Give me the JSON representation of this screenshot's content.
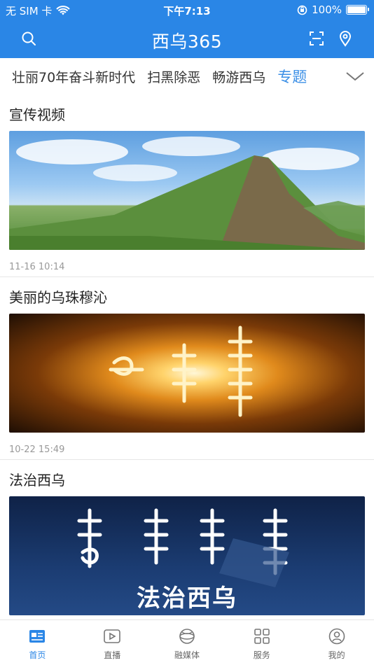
{
  "status_bar": {
    "carrier": "无 SIM 卡",
    "time": "下午7:13",
    "battery": "100%",
    "battery_level": 1.0
  },
  "header": {
    "title": "西乌365",
    "icons": [
      "search-icon",
      "scan-icon",
      "location-icon"
    ]
  },
  "tabs": [
    {
      "label": "壮丽70年奋斗新时代",
      "active": false
    },
    {
      "label": "扫黑除恶",
      "active": false
    },
    {
      "label": "畅游西乌",
      "active": false
    },
    {
      "label": "专题",
      "active": true
    }
  ],
  "feed": [
    {
      "title": "宣传视频",
      "time": "11-16 10:14",
      "image": "mountain-landscape"
    },
    {
      "title": "美丽的乌珠穆沁",
      "time": "10-22 15:49",
      "image": "golden-mongolian-script"
    },
    {
      "title": "法治西乌",
      "time": "",
      "image": "blue-banner",
      "image_text": "法治西乌"
    }
  ],
  "bottom_nav": [
    {
      "label": "首页",
      "icon": "news-icon",
      "active": true
    },
    {
      "label": "直播",
      "icon": "play-icon",
      "active": false
    },
    {
      "label": "融媒体",
      "icon": "globe-icon",
      "active": false
    },
    {
      "label": "服务",
      "icon": "grid-icon",
      "active": false
    },
    {
      "label": "我的",
      "icon": "profile-icon",
      "active": false
    }
  ],
  "colors": {
    "primary": "#2a86e6",
    "active_tab": "#3b8fe6",
    "text": "#222222",
    "muted": "#999999"
  }
}
